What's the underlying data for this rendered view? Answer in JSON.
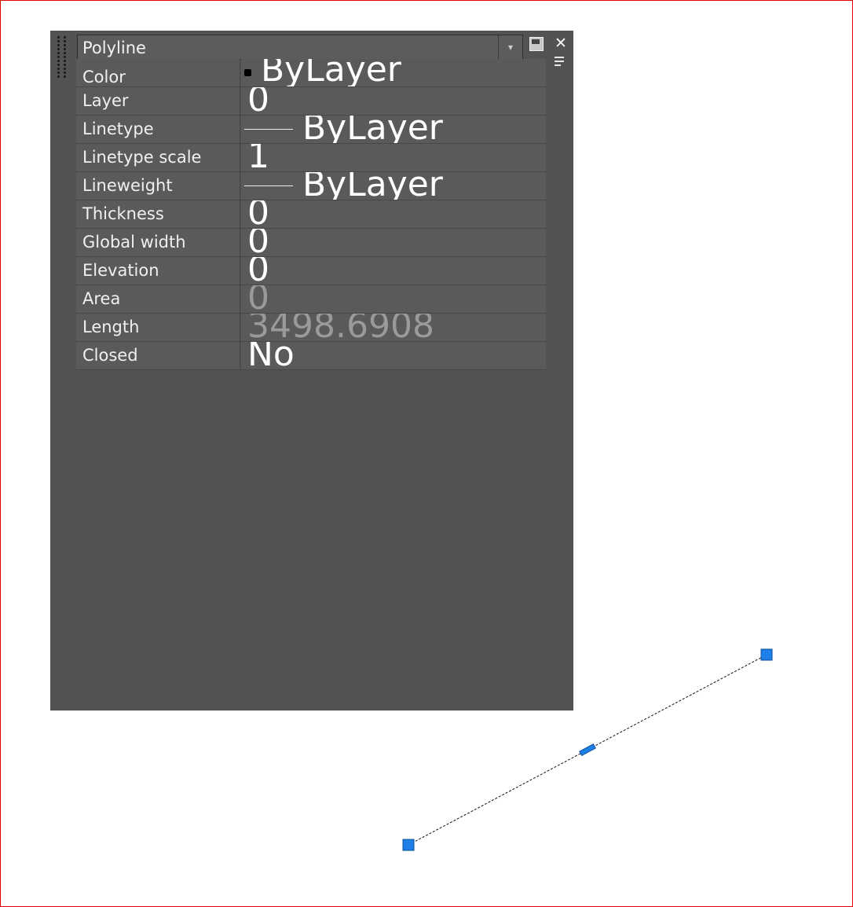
{
  "palette": {
    "object_type": "Polyline",
    "properties": [
      {
        "name": "Color",
        "value": "ByLayer",
        "swatch": "#000000",
        "editable": true
      },
      {
        "name": "Layer",
        "value": "0",
        "editable": true
      },
      {
        "name": "Linetype",
        "value": "ByLayer",
        "editable": true
      },
      {
        "name": "Linetype scale",
        "value": "1",
        "editable": true
      },
      {
        "name": "Lineweight",
        "value": "ByLayer",
        "editable": true
      },
      {
        "name": "Thickness",
        "value": "0",
        "editable": true
      },
      {
        "name": "Global width",
        "value": "0",
        "editable": true
      },
      {
        "name": "Elevation",
        "value": "0",
        "editable": true
      },
      {
        "name": "Area",
        "value": "0",
        "editable": false
      },
      {
        "name": "Length",
        "value": "3498.6908",
        "editable": false
      },
      {
        "name": "Closed",
        "value": "No",
        "editable": true
      }
    ]
  },
  "colors": {
    "grip": "#1e7fe6",
    "viewport_border": "#e00000",
    "palette_bg": "#535353"
  }
}
